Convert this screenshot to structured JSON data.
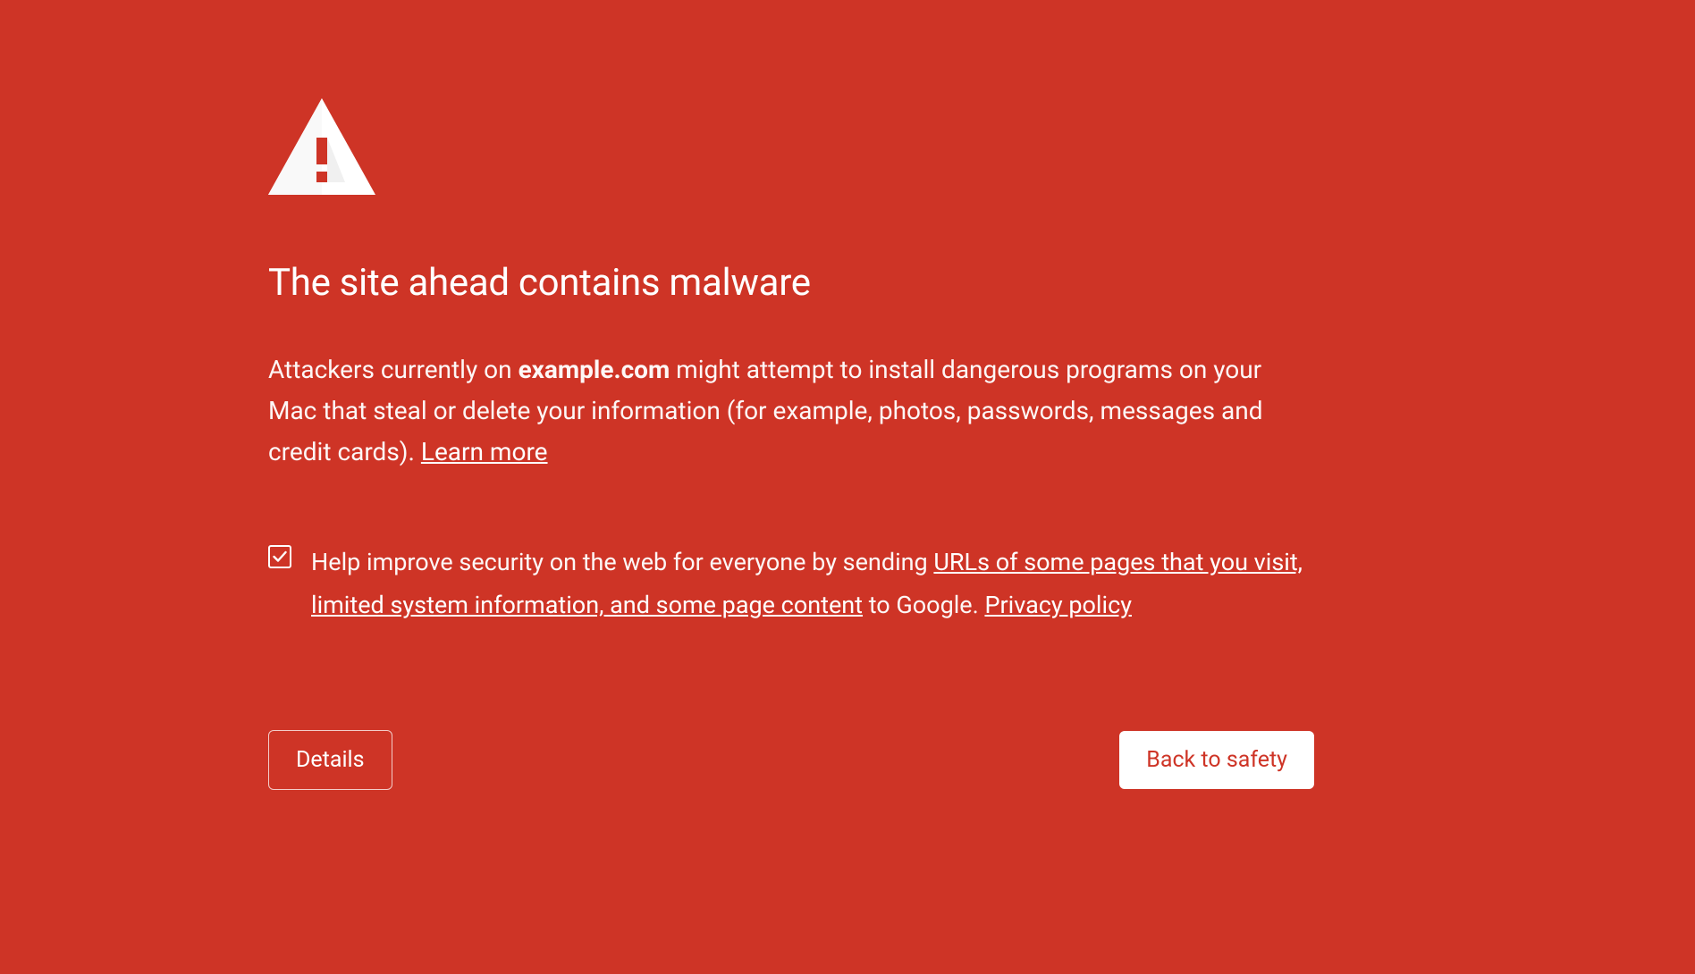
{
  "colors": {
    "background": "#ce3426",
    "primary_text": "#ffffff",
    "button_fill": "#ffffff",
    "button_text": "#ce3426"
  },
  "icon": "warning-triangle",
  "heading": "The site ahead contains malware",
  "description": {
    "prefix": "Attackers currently on ",
    "domain": "example.com",
    "suffix": " might attempt to install dangerous programs on your Mac that steal or delete your information (for example, photos, passwords, messages and credit cards). ",
    "learn_more": "Learn more"
  },
  "opt_in": {
    "checked": true,
    "text_prefix": "Help improve security on the web for everyone by sending ",
    "link1": "URLs of some pages that you visit, limited system information, and some page content",
    "text_mid": " to Google. ",
    "privacy_link": "Privacy policy"
  },
  "buttons": {
    "details": "Details",
    "back_to_safety": "Back to safety"
  }
}
